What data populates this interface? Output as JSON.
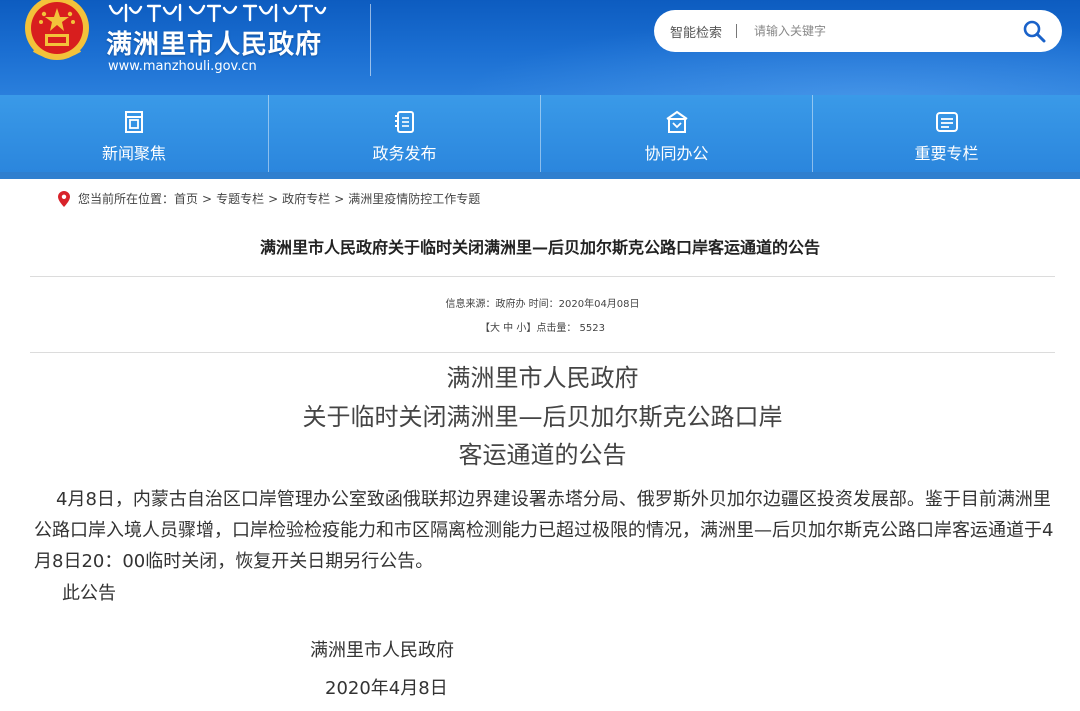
{
  "header": {
    "site_title": "满洲里市人民政府",
    "site_url": "www.manzhouli.gov.cn",
    "search_label": "智能检索",
    "search_placeholder": "请输入关键字"
  },
  "nav": {
    "items": [
      {
        "label": "新闻聚焦",
        "icon": "document-icon"
      },
      {
        "label": "政务发布",
        "icon": "notebook-icon"
      },
      {
        "label": "协同办公",
        "icon": "building-icon"
      },
      {
        "label": "重要专栏",
        "icon": "list-icon"
      }
    ]
  },
  "breadcrumb": {
    "prefix": "您当前所在位置：",
    "items": [
      "首页",
      "专题专栏",
      "政府专栏",
      "满洲里疫情防控工作专题"
    ],
    "separator": ">"
  },
  "article": {
    "title": "满洲里市人民政府关于临时关闭满洲里—后贝加尔斯克公路口岸客运通道的公告",
    "meta_source": "信息来源：政府办 时间：2020年04月08日",
    "size_bracket_open": "【",
    "size_large": "大",
    "size_medium": "中",
    "size_small": "小",
    "size_bracket_close": "】",
    "click_label": "点击量：",
    "click_count": "5523",
    "doc_heading_line1": "满洲里市人民政府",
    "doc_heading_line2": "关于临时关闭满洲里—后贝加尔斯克公路口岸",
    "doc_heading_line3": "客运通道的公告",
    "body": "4月8日，内蒙古自治区口岸管理办公室致函俄联邦边界建设署赤塔分局、俄罗斯外贝加尔边疆区投资发展部。鉴于目前满洲里公路口岸入境人员骤增，口岸检验检疫能力和市区隔离检测能力已超过极限的情况，满洲里—后贝加尔斯克公路口岸客运通道于4月8日20：00临时关闭，恢复开关日期另行公告。",
    "closing": "此公告",
    "signature": "满洲里市人民政府",
    "date": "2020年4月8日"
  },
  "colors": {
    "header_blue": "#1b6fd2",
    "nav_blue": "#3a9ae8",
    "emblem_red": "#d81e1e",
    "emblem_gold": "#f3c23a",
    "search_icon": "#1a62c9"
  }
}
